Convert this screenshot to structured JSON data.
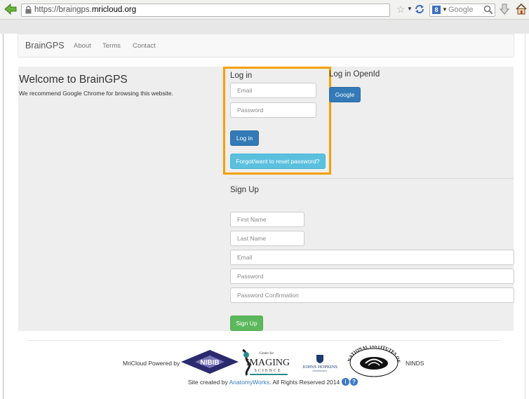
{
  "browser": {
    "url_prefix": "https://braingps.",
    "url_domain": "mricloud.org",
    "search_placeholder": "Google",
    "search_engine_letter": "8"
  },
  "navbar": {
    "brand": "BrainGPS",
    "links": [
      "About",
      "Terms",
      "Contact"
    ]
  },
  "intro": {
    "title": "Welcome to BrainGPS",
    "subtitle": "We recommend Google Chrome for browsing this website."
  },
  "login": {
    "title": "Log in",
    "email_placeholder": "Email",
    "password_placeholder": "Password",
    "login_button": "Log in",
    "forgot_button": "Forgot/want to reset password?",
    "highlight_color": "#f5a000"
  },
  "openid": {
    "title": "Log in OpenId",
    "google_button": "Google"
  },
  "signup": {
    "title": "Sign Up",
    "first_name_placeholder": "First Name",
    "last_name_placeholder": "Last Name",
    "email_placeholder": "Email",
    "password_placeholder": "Password",
    "confirm_placeholder": "Password Confirmation",
    "signup_button": "Sign Up"
  },
  "footer": {
    "powered_by": "MriCloud Powered by",
    "nibib": "NIBIB",
    "cis_title": "IMAGING",
    "cis_top": "Center for",
    "cis_bottom": "SCIENCE",
    "jhu": "JOHNS HOPKINS",
    "jhu_sub": "UNIVERSITY",
    "nih": "NATIONAL INSTITUTES OF HEALTH",
    "ninds": "NINDS",
    "credits_prefix": "Site created by ",
    "credits_link": "AnatomyWorks",
    "credits_suffix": ". All Rights Reserved 2014"
  }
}
